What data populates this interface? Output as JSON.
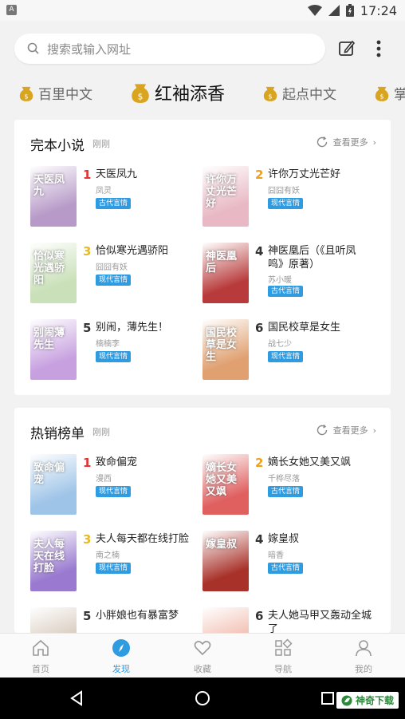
{
  "status": {
    "time": "17:24",
    "left_icon": "A"
  },
  "search": {
    "placeholder": "搜索或输入网址"
  },
  "channels": [
    {
      "label": "百里中文"
    },
    {
      "label": "红袖添香"
    },
    {
      "label": "起点中文"
    },
    {
      "label": "掌"
    }
  ],
  "sections": [
    {
      "title": "完本小说",
      "sub": "刚刚",
      "more": "查看更多",
      "books": [
        {
          "rank": "1",
          "title": "天医凤九",
          "author": "凤灵",
          "tag": "古代言情",
          "cover_text": "天医凤九",
          "cover_color": "#b79ac8"
        },
        {
          "rank": "2",
          "title": "许你万丈光芒好",
          "author": "囧囧有妖",
          "tag": "现代言情",
          "cover_text": "许你万丈光芒好",
          "cover_color": "#e8b8c4"
        },
        {
          "rank": "3",
          "title": "恰似寒光遇骄阳",
          "author": "囧囧有妖",
          "tag": "现代言情",
          "cover_text": "恰似寒光遇骄阳",
          "cover_color": "#c9e0b8"
        },
        {
          "rank": "4",
          "title": "神医凰后（《且听凤鸣》原著）",
          "author": "苏小暖",
          "tag": "古代言情",
          "cover_text": "神医凰后",
          "cover_color": "#b83a3a"
        },
        {
          "rank": "5",
          "title": "别闹，薄先生！",
          "author": "楠楠李",
          "tag": "现代言情",
          "cover_text": "别闹薄先生",
          "cover_color": "#c7a0e0"
        },
        {
          "rank": "6",
          "title": "国民校草是女生",
          "author": "战七少",
          "tag": "现代言情",
          "cover_text": "国民校草是女生",
          "cover_color": "#e0a070"
        }
      ]
    },
    {
      "title": "热销榜单",
      "sub": "刚刚",
      "more": "查看更多",
      "books": [
        {
          "rank": "1",
          "title": "致命偏宠",
          "author": "漫西",
          "tag": "现代言情",
          "cover_text": "致命偏宠",
          "cover_color": "#9ec4e8"
        },
        {
          "rank": "2",
          "title": "嫡长女她又美又飒",
          "author": "千桦尽落",
          "tag": "古代言情",
          "cover_text": "嫡长女她又美又飒",
          "cover_color": "#e06060"
        },
        {
          "rank": "3",
          "title": "夫人每天都在线打脸",
          "author": "南之楠",
          "tag": "现代言情",
          "cover_text": "夫人每天在线打脸",
          "cover_color": "#9a7ad0"
        },
        {
          "rank": "4",
          "title": "嫁皇叔",
          "author": "暗香",
          "tag": "古代言情",
          "cover_text": "嫁皇叔",
          "cover_color": "#a8322a"
        },
        {
          "rank": "5",
          "title": "小胖娘也有暴富梦",
          "author": "",
          "tag": "",
          "cover_text": "",
          "cover_color": "#d0c0b0"
        },
        {
          "rank": "6",
          "title": "夫人她马甲又轰动全城了",
          "author": "",
          "tag": "",
          "cover_text": "",
          "cover_color": "#f0b0a0"
        }
      ]
    }
  ],
  "bottom_nav": [
    {
      "label": "首页",
      "icon": "home-icon"
    },
    {
      "label": "发现",
      "icon": "compass-icon"
    },
    {
      "label": "收藏",
      "icon": "heart-icon"
    },
    {
      "label": "导航",
      "icon": "grid-icon"
    },
    {
      "label": "我的",
      "icon": "user-icon"
    }
  ],
  "watermark": "神奇下载",
  "colors": {
    "accent": "#2f9be0",
    "rank1": "#e23434",
    "rank2": "#f0a020",
    "rank3": "#e9b92a"
  }
}
